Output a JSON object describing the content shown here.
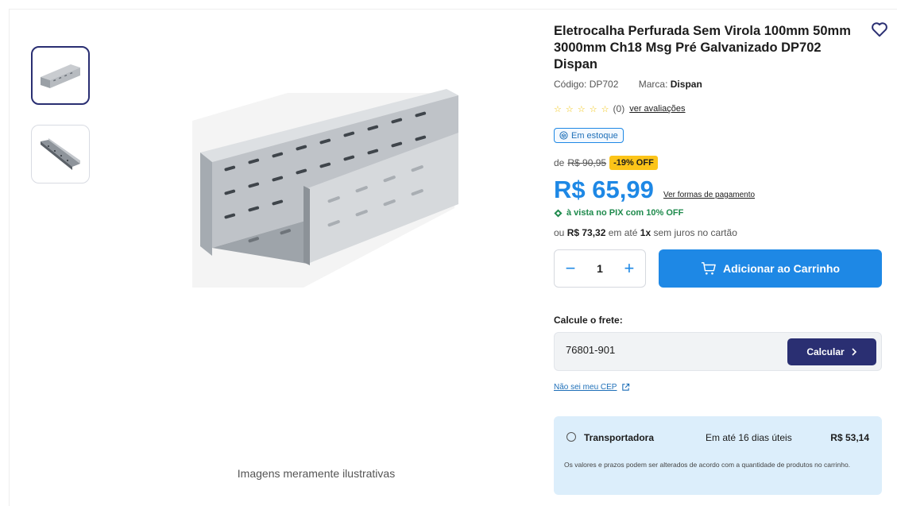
{
  "gallery": {
    "thumbnails": [
      "thumb-1",
      "thumb-2"
    ],
    "caption": "Imagens meramente ilustrativas"
  },
  "product": {
    "title": "Eletrocalha Perfurada Sem Virola 100mm 50mm 3000mm Ch18 Msg Pré Galvanizado DP702 Dispan",
    "code_label": "Código: DP702",
    "brand_label": "Marca:",
    "brand_value": "Dispan",
    "rating_stars": "☆ ☆ ☆ ☆ ☆",
    "rating_count": "(0)",
    "reviews_link": "ver avaliações",
    "stock_label": "Em estoque"
  },
  "pricing": {
    "old_prefix": "de",
    "old_price": "R$ 90,95",
    "discount": "-19% OFF",
    "price": "R$ 65,99",
    "payment_link": "Ver formas de pagamento",
    "pix_text": "à vista no PIX com 10% OFF",
    "inst_prefix": "ou",
    "inst_value": "R$ 73,32",
    "inst_mid": "em até",
    "inst_count": "1x",
    "inst_suffix": "sem juros no cartão"
  },
  "cart": {
    "quantity": "1",
    "minus": "−",
    "plus": "+",
    "add_label": "Adicionar ao Carrinho"
  },
  "shipping": {
    "label": "Calcule o frete:",
    "cep_value": "76801-901",
    "calc_label": "Calcular",
    "no_cep_link": "Não sei meu CEP",
    "option": {
      "carrier": "Transportadora",
      "eta": "Em até 16 dias úteis",
      "price": "R$ 53,14"
    },
    "note": "Os valores e prazos podem ser alterados de acordo com a quantidade de produtos no carrinho."
  },
  "colors": {
    "accent": "#1e88e5",
    "dark_button": "#2a2f72",
    "discount": "#fcc419",
    "pix": "#1e8a4c",
    "shipping_bg": "#dceefb"
  },
  "icons": [
    "heart-icon",
    "stock-box-icon",
    "pix-icon",
    "cart-icon",
    "chevron-right-icon",
    "external-link-icon"
  ]
}
